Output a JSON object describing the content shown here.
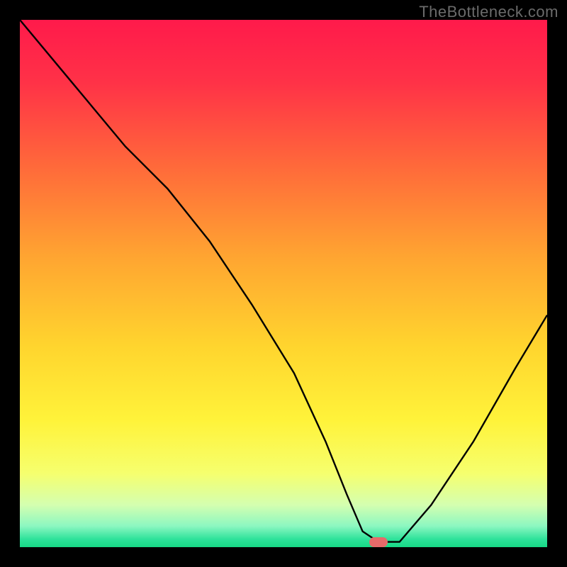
{
  "watermark": "TheBottleneck.com",
  "chart_data": {
    "type": "line",
    "title": "",
    "xlabel": "",
    "ylabel": "",
    "xlim": [
      0,
      100
    ],
    "ylim": [
      0,
      100
    ],
    "series": [
      {
        "name": "curve",
        "x": [
          0,
          10,
          20,
          28,
          36,
          44,
          52,
          58,
          62,
          65,
          68,
          72,
          78,
          86,
          94,
          100
        ],
        "y": [
          100,
          88,
          76,
          68,
          58,
          46,
          33,
          20,
          10,
          3,
          1,
          1,
          8,
          20,
          34,
          44
        ]
      }
    ],
    "minimum_marker": {
      "x": 68,
      "y": 1
    },
    "gradient_stops": [
      {
        "offset": 0.0,
        "color": "#ff1a4b"
      },
      {
        "offset": 0.12,
        "color": "#ff3247"
      },
      {
        "offset": 0.28,
        "color": "#ff6a3a"
      },
      {
        "offset": 0.45,
        "color": "#ffa531"
      },
      {
        "offset": 0.62,
        "color": "#ffd52e"
      },
      {
        "offset": 0.76,
        "color": "#fff33a"
      },
      {
        "offset": 0.86,
        "color": "#f6ff6e"
      },
      {
        "offset": 0.92,
        "color": "#d4ffb0"
      },
      {
        "offset": 0.96,
        "color": "#8cf7c1"
      },
      {
        "offset": 0.985,
        "color": "#2de29a"
      },
      {
        "offset": 1.0,
        "color": "#17d985"
      }
    ]
  }
}
